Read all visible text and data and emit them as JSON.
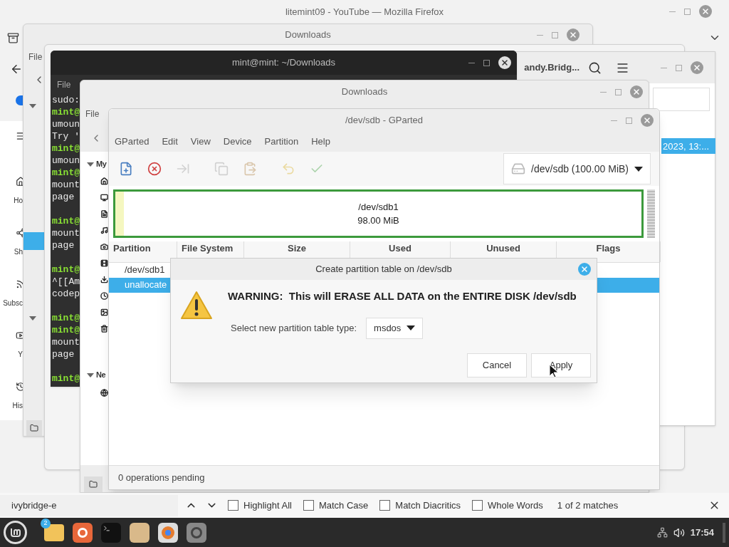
{
  "firefox": {
    "title": "litemint09 - YouTube — Mozilla Firefox",
    "sidebar": [
      "Ho",
      "Sh",
      "Subsc",
      "Y",
      "His"
    ],
    "find_bar": {
      "value": "ivybridge-e",
      "options": [
        {
          "label": "Highlight All",
          "checked": false
        },
        {
          "label": "Match Case",
          "checked": false
        },
        {
          "label": "Match Diacritics",
          "checked": false
        },
        {
          "label": "Whole Words",
          "checked": false
        }
      ],
      "matches": "1 of 2 matches"
    }
  },
  "downloads_back": {
    "title": "Downloads",
    "menu": "File"
  },
  "files_window": {
    "title": "andy.Bridg...",
    "row": "2023, 13:..."
  },
  "terminal": {
    "title": "mint@mint: ~/Downloads",
    "menu": "File",
    "lines": [
      {
        "kind": "output",
        "text": "sudo:"
      },
      {
        "kind": "prompt",
        "text": "mint@"
      },
      {
        "kind": "output",
        "text": "umoun"
      },
      {
        "kind": "output",
        "text": "Try '"
      },
      {
        "kind": "prompt",
        "text": "mint@"
      },
      {
        "kind": "output",
        "text": "umoun"
      },
      {
        "kind": "prompt",
        "text": "mint@"
      },
      {
        "kind": "output",
        "text": "mount"
      },
      {
        "kind": "output",
        "text": "page"
      },
      {
        "kind": "blank"
      },
      {
        "kind": "prompt",
        "text": "mint@"
      },
      {
        "kind": "output",
        "text": "mount"
      },
      {
        "kind": "output",
        "text": "page"
      },
      {
        "kind": "blank"
      },
      {
        "kind": "prompt",
        "text": "mint@"
      },
      {
        "kind": "output",
        "text": "^[[Am"
      },
      {
        "kind": "output",
        "text": "codep"
      },
      {
        "kind": "blank"
      },
      {
        "kind": "prompt",
        "text": "mint@"
      },
      {
        "kind": "prompt",
        "text": "mint@"
      },
      {
        "kind": "output",
        "text": "mount"
      },
      {
        "kind": "output",
        "text": "page"
      },
      {
        "kind": "blank"
      },
      {
        "kind": "prompt",
        "text": "mint@"
      }
    ]
  },
  "downloads_front": {
    "title": "Downloads",
    "menu": "File",
    "sections": [
      "My",
      "Ne"
    ]
  },
  "gparted": {
    "title": "/dev/sdb - GParted",
    "menu": [
      "GParted",
      "Edit",
      "View",
      "Device",
      "Partition",
      "Help"
    ],
    "toolbar": [
      {
        "kind": "new",
        "disabled": false
      },
      {
        "kind": "delete",
        "disabled": false
      },
      {
        "kind": "resize",
        "disabled": true
      },
      {
        "kind": "copy",
        "disabled": true
      },
      {
        "kind": "paste",
        "disabled": true
      },
      {
        "kind": "undo",
        "disabled": true
      },
      {
        "kind": "apply",
        "disabled": true
      }
    ],
    "device": "/dev/sdb (100.00 MiB)",
    "partition_map": {
      "name": "/dev/sdb1",
      "size": "98.00 MiB"
    },
    "columns": [
      "Partition",
      "File System",
      "Size",
      "Used",
      "Unused",
      "Flags"
    ],
    "rows": [
      {
        "partition": "/dev/sdb1",
        "selected": false
      },
      {
        "partition": "unallocate",
        "selected": true
      }
    ],
    "status": "0 operations pending"
  },
  "dialog": {
    "title": "Create partition table on /dev/sdb",
    "warning": "WARNING:  This will ERASE ALL DATA on the ENTIRE DISK /dev/sdb",
    "label": "Select new partition table type:",
    "value": "msdos",
    "buttons": [
      "Cancel",
      "Apply"
    ]
  },
  "taskbar": {
    "badge": "2",
    "clock": "17:54"
  }
}
